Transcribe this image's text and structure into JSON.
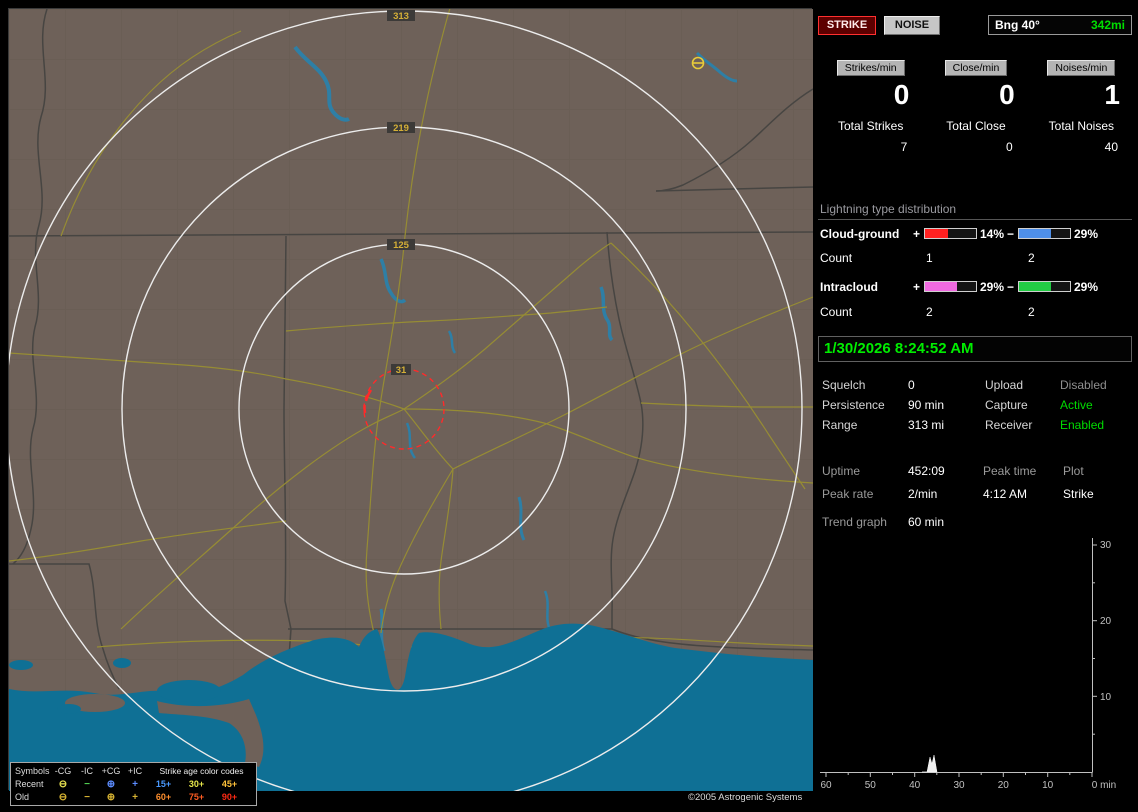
{
  "map": {
    "range_labels": [
      "313",
      "219",
      "125",
      "31"
    ],
    "noise_marker": {
      "symbol": "circled-minus",
      "color": "#e8cc3a"
    },
    "copyright": "©2005 Astrogenic Systems",
    "legend": {
      "title": "Symbols",
      "columns": [
        "-CG",
        "-IC",
        "+CG",
        "+IC"
      ],
      "age_title": "Strike age color codes",
      "rows": [
        {
          "label": "Recent",
          "symbols": [
            {
              "glyph": "⊖",
              "color": "#e6e050"
            },
            {
              "glyph": "−",
              "color": "#52d052"
            },
            {
              "glyph": "⊕",
              "color": "#5c8cff"
            },
            {
              "glyph": "+",
              "color": "#5c8cff"
            }
          ],
          "ages": [
            {
              "text": "15+",
              "color": "#4a9aff"
            },
            {
              "text": "30+",
              "color": "#e8e84a"
            },
            {
              "text": "45+",
              "color": "#ffc23a"
            }
          ]
        },
        {
          "label": "Old",
          "symbols": [
            {
              "glyph": "⊖",
              "color": "#d8b433"
            },
            {
              "glyph": "−",
              "color": "#d8b433"
            },
            {
              "glyph": "⊕",
              "color": "#d8b433"
            },
            {
              "glyph": "+",
              "color": "#d8b433"
            }
          ],
          "ages": [
            {
              "text": "60+",
              "color": "#ff8f2e"
            },
            {
              "text": "75+",
              "color": "#ff5d22"
            },
            {
              "text": "90+",
              "color": "#ff2a14"
            }
          ]
        }
      ]
    }
  },
  "panel": {
    "strike_button": "STRIKE",
    "noise_button": "NOISE",
    "bearing": {
      "label": "Bng 40°",
      "value": "342mi",
      "value_color": "#00dd00"
    },
    "rates": [
      {
        "badge": "Strikes/min",
        "value": "0"
      },
      {
        "badge": "Close/min",
        "value": "0"
      },
      {
        "badge": "Noises/min",
        "value": "1"
      }
    ],
    "totals": [
      {
        "label": "Total Strikes",
        "value": "7"
      },
      {
        "label": "Total Close",
        "value": "0"
      },
      {
        "label": "Total Noises",
        "value": "40"
      }
    ],
    "distribution": {
      "title": "Lightning type distribution",
      "count_label": "Count",
      "plus_sign": "+",
      "minus_sign": "−",
      "rows": [
        {
          "label": "Cloud-ground",
          "plus": {
            "pct": "14%",
            "color": "#ff2020",
            "fill": 45
          },
          "minus": {
            "pct": "29%",
            "color": "#4f8fe8",
            "fill": 62
          },
          "counts": [
            "1",
            "2"
          ]
        },
        {
          "label": "Intracloud",
          "plus": {
            "pct": "29%",
            "color": "#f06ae0",
            "fill": 62
          },
          "minus": {
            "pct": "29%",
            "color": "#22cc44",
            "fill": 62
          },
          "counts": [
            "2",
            "2"
          ]
        }
      ]
    },
    "datetime": "1/30/2026 8:24:52 AM",
    "status_rows": [
      {
        "label1": "Squelch",
        "value1": "0",
        "label2": "Upload",
        "value2": "Disabled",
        "value2_color": "#8f8f8f"
      },
      {
        "label1": "Persistence",
        "value1": "90 min",
        "label2": "Capture",
        "value2": "Active",
        "value2_color": "#00dd00"
      },
      {
        "label1": "Range",
        "value1": "313 mi",
        "label2": "Receiver",
        "value2": "Enabled",
        "value2_color": "#00dd00"
      }
    ],
    "stats": {
      "uptime_label": "Uptime",
      "uptime_value": "452:09",
      "peak_time_label": "Peak time",
      "peak_time_value": "4:12 AM",
      "plot_label": "Plot",
      "plot_value": "Strike",
      "peak_rate_label": "Peak rate",
      "peak_rate_value": "2/min",
      "trend_label": "Trend graph",
      "trend_value": "60 min"
    }
  },
  "chart_data": {
    "type": "line",
    "title": "Strike rate trend, last 60 minutes",
    "xlabel": "min",
    "x_range": [
      60,
      0
    ],
    "y_range": [
      0,
      30
    ],
    "x_tick_labels": [
      "60",
      "50",
      "40",
      "30",
      "20",
      "10",
      "0 min"
    ],
    "y_tick_labels": [
      "30",
      "20",
      "10"
    ],
    "grid": false,
    "legend_position": "none",
    "series": [
      {
        "name": "Strike",
        "x_min_ago": [
          60,
          37,
          36,
          35.5,
          35,
          34,
          0
        ],
        "values": [
          0,
          0,
          2,
          1,
          2,
          0,
          0
        ]
      }
    ]
  },
  "colors": {
    "map_land": "#6e6159",
    "water": "#0f7095",
    "range_ring": "#ececec",
    "alarm_ring": "#ff2a2a",
    "road": "#968c34",
    "range_label": "#d4af37",
    "accent_green": "#00dd00"
  }
}
